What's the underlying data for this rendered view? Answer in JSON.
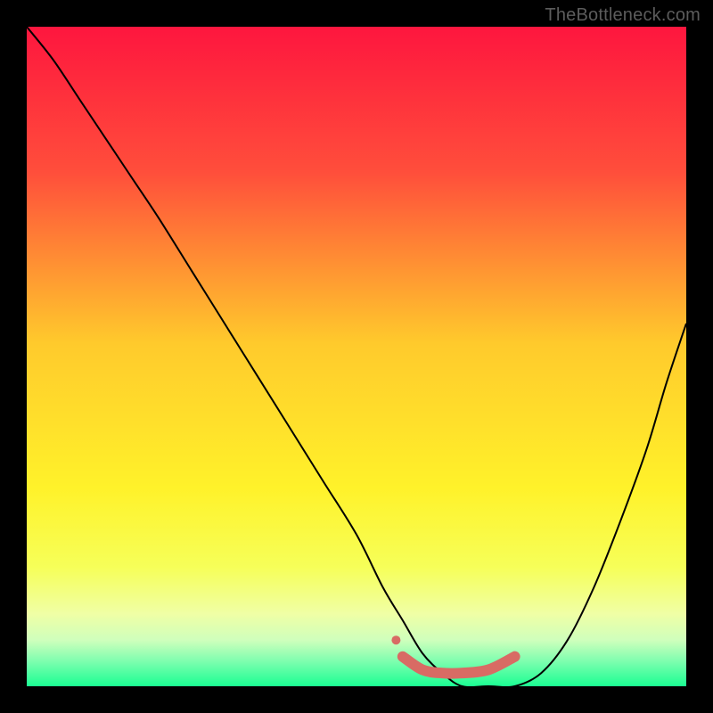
{
  "watermark": "TheBottleneck.com",
  "chart_data": {
    "type": "line",
    "title": "",
    "xlabel": "",
    "ylabel": "",
    "xlim": [
      0,
      100
    ],
    "ylim": [
      0,
      100
    ],
    "background_gradient_stops": [
      {
        "pct": 0,
        "color": "#fe163e"
      },
      {
        "pct": 22,
        "color": "#ff4e3b"
      },
      {
        "pct": 48,
        "color": "#ffca2c"
      },
      {
        "pct": 70,
        "color": "#fff22a"
      },
      {
        "pct": 82,
        "color": "#f6ff59"
      },
      {
        "pct": 89,
        "color": "#f0ffa5"
      },
      {
        "pct": 93,
        "color": "#cfffbc"
      },
      {
        "pct": 96,
        "color": "#83feb0"
      },
      {
        "pct": 100,
        "color": "#1bfe93"
      }
    ],
    "series": [
      {
        "name": "bottleneck-curve",
        "color": "#000000",
        "width": 2,
        "x": [
          0,
          4,
          8,
          12,
          16,
          20,
          25,
          30,
          35,
          40,
          45,
          50,
          54,
          57,
          60,
          63,
          66,
          70,
          74,
          78,
          82,
          86,
          90,
          94,
          97,
          100
        ],
        "y": [
          100,
          95,
          89,
          83,
          77,
          71,
          63,
          55,
          47,
          39,
          31,
          23,
          15,
          10,
          5,
          2,
          0,
          0,
          0,
          2,
          7,
          15,
          25,
          36,
          46,
          55
        ]
      },
      {
        "name": "optimal-region",
        "color": "#d86b64",
        "width": 12,
        "linecap": "round",
        "x": [
          57,
          60,
          63,
          66,
          70,
          74
        ],
        "y": [
          4.5,
          2.5,
          2.0,
          2.0,
          2.5,
          4.5
        ]
      }
    ],
    "markers": [
      {
        "name": "marker-dot",
        "x": 56,
        "y": 7,
        "r": 5,
        "color": "#d86b64"
      }
    ]
  }
}
